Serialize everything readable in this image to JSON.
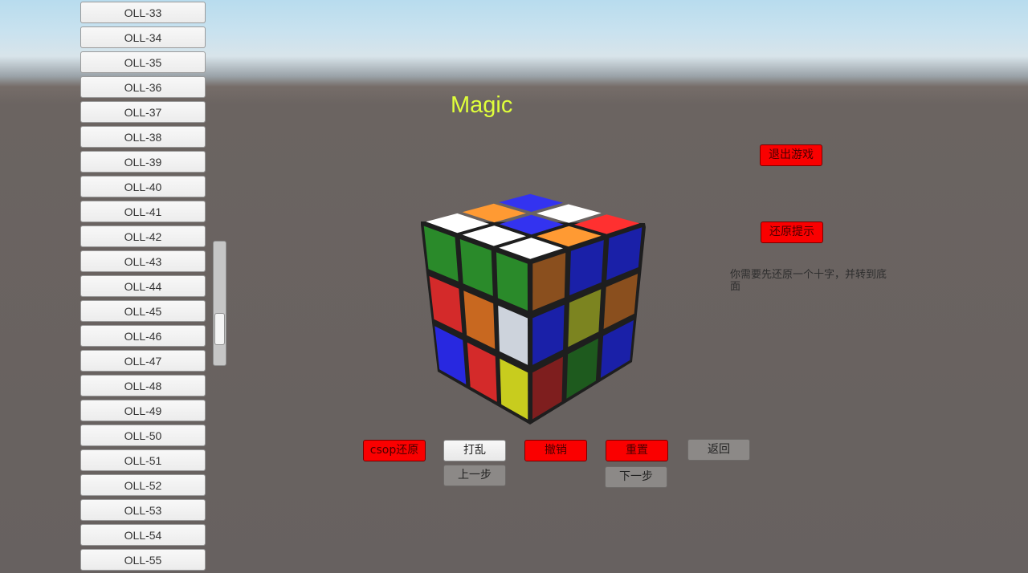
{
  "title": "Magic",
  "oll_list": [
    "OLL-33",
    "OLL-34",
    "OLL-35",
    "OLL-36",
    "OLL-37",
    "OLL-38",
    "OLL-39",
    "OLL-40",
    "OLL-41",
    "OLL-42",
    "OLL-43",
    "OLL-44",
    "OLL-45",
    "OLL-46",
    "OLL-47",
    "OLL-48",
    "OLL-49",
    "OLL-50",
    "OLL-51",
    "OLL-52",
    "OLL-53",
    "OLL-54",
    "OLL-55"
  ],
  "buttons": {
    "exit_game": "退出游戏",
    "solve_hint": "还原提示",
    "csop_solve": "csop还原",
    "scramble": "打乱",
    "undo": "撤销",
    "reset": "重置",
    "back": "返回",
    "prev_step": "上一步",
    "next_step": "下一步"
  },
  "hint_text": "你需要先还原一个十字，并转到底面",
  "cube": {
    "top": [
      [
        "#ffffff",
        "#ff9a33",
        "#3333f0"
      ],
      [
        "#ffffff",
        "#3333f0",
        "#ffffff"
      ],
      [
        "#ffffff",
        "#ff9a33",
        "#ff3030"
      ]
    ],
    "left": [
      [
        "#2a8a2a",
        "#2a8a2a",
        "#2a8a2a"
      ],
      [
        "#d42a2a",
        "#c86820",
        "#cdd3dc"
      ],
      [
        "#2828e0",
        "#d42a2a",
        "#c8cc1e"
      ]
    ],
    "right": [
      [
        "#8a4f1e",
        "#1a20a8",
        "#1a20a8"
      ],
      [
        "#1a20a8",
        "#7c8420",
        "#8a4f1e"
      ],
      [
        "#7e1e1e",
        "#1e5a1e",
        "#1a20a8"
      ]
    ]
  },
  "colors": {
    "title": "#e0ff3a",
    "button_red": "#fa0000",
    "ground": "#676160",
    "sky": "#b8dcee"
  }
}
